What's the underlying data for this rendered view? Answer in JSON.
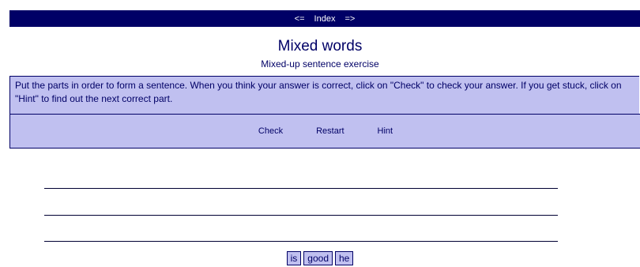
{
  "nav": {
    "prev": "<=",
    "index": "Index",
    "next": "=>"
  },
  "header": {
    "title": "Mixed words",
    "subtitle": "Mixed-up sentence exercise"
  },
  "instructions": "Put the parts in order to form a sentence. When you think your answer is correct, click on \"Check\" to check your answer. If you get stuck, click on \"Hint\" to find out the next correct part.",
  "buttons": {
    "check": "Check",
    "restart": "Restart",
    "hint": "Hint"
  },
  "word_tiles": [
    "is",
    "good",
    "he"
  ]
}
